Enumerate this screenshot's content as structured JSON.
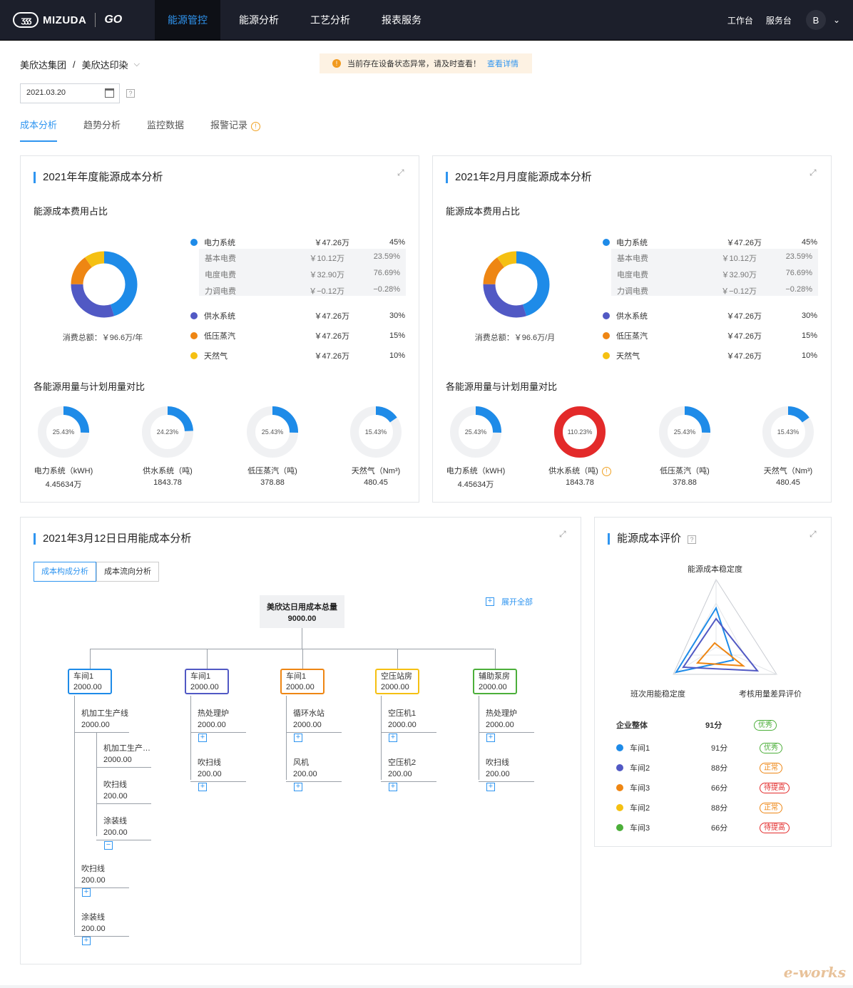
{
  "header": {
    "logo_text": "MIZUDA",
    "logo_mark": "ʒʒʒ",
    "logo_go": "GO",
    "nav": [
      "能源管控",
      "能源分析",
      "工艺分析",
      "报表服务"
    ],
    "right_links": [
      "工作台",
      "服务台"
    ],
    "avatar": "B"
  },
  "breadcrumb": {
    "group": "美欣达集团",
    "company": "美欣达印染"
  },
  "alert": {
    "text": "当前存在设备状态异常，请及时查看！",
    "link": "查看详情"
  },
  "date": "2021.03.20",
  "qmark": "?",
  "tabs": [
    "成本分析",
    "趋势分析",
    "监控数据",
    "报警记录"
  ],
  "annual": {
    "title": "2021年年度能源成本分析",
    "ratio_title": "能源成本费用占比",
    "total": "消费总额：￥96.6万/年",
    "compare_title": "各能源用量与计划用量对比"
  },
  "monthly": {
    "title": "2021年2月月度能源成本分析",
    "ratio_title": "能源成本费用占比",
    "total": "消费总额：￥96.6万/月",
    "compare_title": "各能源用量与计划用量对比"
  },
  "legend": [
    {
      "name": "电力系统",
      "value": "￥47.26万",
      "pct": "45%",
      "color": "#1e8be8"
    },
    {
      "name": "供水系统",
      "value": "￥47.26万",
      "pct": "30%",
      "color": "#5159c4"
    },
    {
      "name": "低压蒸汽",
      "value": "￥47.26万",
      "pct": "15%",
      "color": "#ee8613"
    },
    {
      "name": "天然气",
      "value": "￥47.26万",
      "pct": "10%",
      "color": "#f5c012"
    }
  ],
  "elec_sub": [
    {
      "name": "基本电费",
      "value": "￥10.12万",
      "pct": "23.59%"
    },
    {
      "name": "电度电费",
      "value": "￥32.90万",
      "pct": "76.69%"
    },
    {
      "name": "力调电费",
      "value": "￥−0.12万",
      "pct": "−0.28%"
    }
  ],
  "chart_data": [
    {
      "type": "pie",
      "title": "能源成本费用占比",
      "categories": [
        "电力系统",
        "供水系统",
        "低压蒸汽",
        "天然气"
      ],
      "values": [
        45,
        30,
        15,
        10
      ]
    },
    {
      "type": "pie",
      "title": "能源成本费用占比",
      "categories": [
        "电力系统",
        "供水系统",
        "低压蒸汽",
        "天然气"
      ],
      "values": [
        45,
        30,
        15,
        10
      ]
    }
  ],
  "annual_rings": [
    {
      "pct": "25.43%",
      "frac": 0.2543,
      "name": "电力系统（kWH)",
      "value": "4.45634万",
      "color": "#1e8be8"
    },
    {
      "pct": "24.23%",
      "frac": 0.2423,
      "name": "供水系统（吨)",
      "value": "1843.78",
      "color": "#1e8be8"
    },
    {
      "pct": "25.43%",
      "frac": 0.2543,
      "name": "低压蒸汽（吨)",
      "value": "378.88",
      "color": "#1e8be8"
    },
    {
      "pct": "15.43%",
      "frac": 0.1543,
      "name": "天然气（Nm³)",
      "value": "480.45",
      "color": "#1e8be8"
    }
  ],
  "monthly_rings": [
    {
      "pct": "25.43%",
      "frac": 0.2543,
      "name": "电力系统（kWH)",
      "value": "4.45634万",
      "color": "#1e8be8"
    },
    {
      "pct": "110.23%",
      "frac": 1.0,
      "name": "供水系统（吨)",
      "value": "1843.78",
      "color": "#e32a2a"
    },
    {
      "pct": "25.43%",
      "frac": 0.2543,
      "name": "低压蒸汽（吨)",
      "value": "378.88",
      "color": "#1e8be8"
    },
    {
      "pct": "15.43%",
      "frac": 0.1543,
      "name": "天然气（Nm³)",
      "value": "480.45",
      "color": "#1e8be8"
    }
  ],
  "daily": {
    "title": "2021年3月12日日用能成本分析",
    "btn_a": "成本构成分析",
    "btn_b": "成本流向分析",
    "root_name": "美欣达日用成本总量",
    "root_value": "9000.00",
    "expand_all": "展开全部"
  },
  "tree": [
    {
      "name": "车间1",
      "value": "2000.00",
      "color": "#1e8be8",
      "leaves": [
        {
          "n": "机加工生产线",
          "v": "2000.00"
        }
      ],
      "sub": [
        {
          "n": "机加工生产…",
          "v": "2000.00"
        },
        {
          "n": "吹扫线",
          "v": "200.00"
        },
        {
          "n": "涂装线",
          "v": "200.00"
        }
      ],
      "more": [
        {
          "n": "吹扫线",
          "v": "200.00"
        },
        {
          "n": "涂装线",
          "v": "200.00"
        }
      ]
    },
    {
      "name": "车间1",
      "value": "2000.00",
      "color": "#5159c4",
      "leaves": [
        {
          "n": "热处理炉",
          "v": "2000.00"
        },
        {
          "n": "吹扫线",
          "v": "200.00"
        }
      ]
    },
    {
      "name": "车间1",
      "value": "2000.00",
      "color": "#ee8613",
      "leaves": [
        {
          "n": "循环水站",
          "v": "2000.00"
        },
        {
          "n": "风机",
          "v": "200.00"
        }
      ]
    },
    {
      "name": "空压站房",
      "value": "2000.00",
      "color": "#f5c012",
      "leaves": [
        {
          "n": "空压机1",
          "v": "2000.00"
        },
        {
          "n": "空压机2",
          "v": "200.00"
        }
      ]
    },
    {
      "name": "辅助泵房",
      "value": "2000.00",
      "color": "#4caf3a",
      "leaves": [
        {
          "n": "热处理炉",
          "v": "2000.00"
        },
        {
          "n": "吹扫线",
          "v": "200.00"
        }
      ]
    }
  ],
  "evaluation": {
    "title": "能源成本评价",
    "axis_top": "能源成本稳定度",
    "axis_left": "班次用能稳定度",
    "axis_right": "考核用量差异评价",
    "overall": {
      "name": "企业整体",
      "score": "91分",
      "badge": "优秀",
      "color": "#4caf3a"
    },
    "rows": [
      {
        "name": "车间1",
        "score": "91分",
        "badge": "优秀",
        "dot": "#1e8be8",
        "color": "#4caf3a"
      },
      {
        "name": "车间2",
        "score": "88分",
        "badge": "正常",
        "dot": "#5159c4",
        "color": "#ee8613"
      },
      {
        "name": "车间3",
        "score": "66分",
        "badge": "待提高",
        "dot": "#ee8613",
        "color": "#e32a2a"
      },
      {
        "name": "车间2",
        "score": "88分",
        "badge": "正常",
        "dot": "#f5c012",
        "color": "#ee8613"
      },
      {
        "name": "车间3",
        "score": "66分",
        "badge": "待提高",
        "dot": "#4caf3a",
        "color": "#e32a2a"
      }
    ]
  },
  "watermark": "e-works"
}
